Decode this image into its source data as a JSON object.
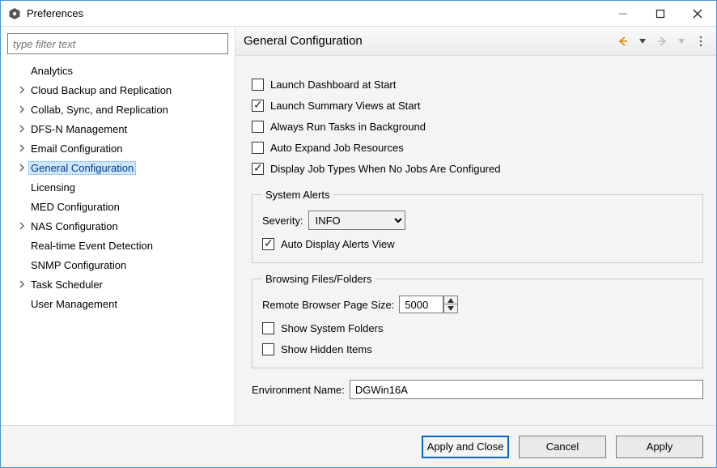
{
  "window": {
    "title": "Preferences"
  },
  "filter": {
    "placeholder": "type filter text"
  },
  "tree": [
    {
      "label": "Analytics",
      "expandable": false
    },
    {
      "label": "Cloud Backup and Replication",
      "expandable": true
    },
    {
      "label": "Collab, Sync, and Replication",
      "expandable": true
    },
    {
      "label": "DFS-N Management",
      "expandable": true
    },
    {
      "label": "Email Configuration",
      "expandable": true
    },
    {
      "label": "General Configuration",
      "expandable": true,
      "selected": true
    },
    {
      "label": "Licensing",
      "expandable": false
    },
    {
      "label": "MED Configuration",
      "expandable": false
    },
    {
      "label": "NAS Configuration",
      "expandable": true
    },
    {
      "label": "Real-time Event Detection",
      "expandable": false
    },
    {
      "label": "SNMP Configuration",
      "expandable": false
    },
    {
      "label": "Task Scheduler",
      "expandable": true
    },
    {
      "label": "User Management",
      "expandable": false
    }
  ],
  "page": {
    "title": "General Configuration",
    "checks": {
      "launch_dashboard": {
        "label": "Launch Dashboard at Start",
        "checked": false
      },
      "launch_summary": {
        "label": "Launch Summary Views at Start",
        "checked": true
      },
      "always_background": {
        "label": "Always Run Tasks in Background",
        "checked": false
      },
      "auto_expand": {
        "label": "Auto Expand Job Resources",
        "checked": false
      },
      "display_jobtypes": {
        "label": "Display Job Types When No Jobs Are Configured",
        "checked": true
      }
    },
    "alerts": {
      "legend": "System Alerts",
      "severity_label": "Severity:",
      "severity_value": "INFO",
      "autodisplay": {
        "label": "Auto Display Alerts View",
        "checked": true
      }
    },
    "browse": {
      "legend": "Browsing Files/Folders",
      "pagesize_label": "Remote Browser Page Size:",
      "pagesize_value": "5000",
      "show_system": {
        "label": "Show System Folders",
        "checked": false
      },
      "show_hidden": {
        "label": "Show Hidden Items",
        "checked": false
      }
    },
    "env_label": "Environment Name:",
    "env_value": "DGWin16A"
  },
  "footer": {
    "apply_close": "Apply and Close",
    "cancel": "Cancel",
    "apply": "Apply"
  }
}
